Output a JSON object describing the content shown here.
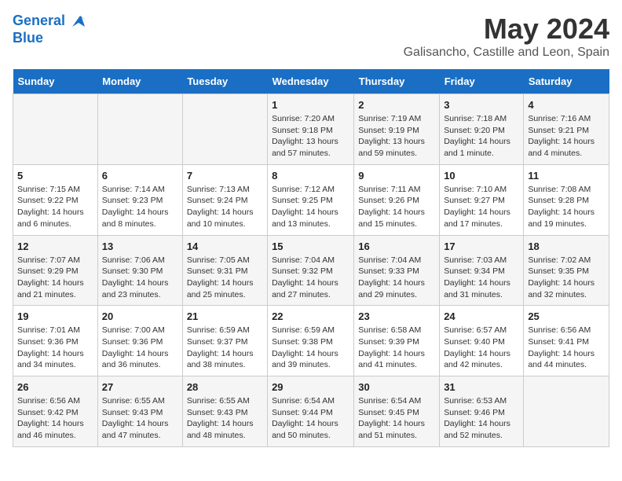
{
  "header": {
    "logo_line1": "General",
    "logo_line2": "Blue",
    "title": "May 2024",
    "subtitle": "Galisancho, Castille and Leon, Spain"
  },
  "days_of_week": [
    "Sunday",
    "Monday",
    "Tuesday",
    "Wednesday",
    "Thursday",
    "Friday",
    "Saturday"
  ],
  "weeks": [
    [
      {
        "num": "",
        "sunrise": "",
        "sunset": "",
        "daylight": ""
      },
      {
        "num": "",
        "sunrise": "",
        "sunset": "",
        "daylight": ""
      },
      {
        "num": "",
        "sunrise": "",
        "sunset": "",
        "daylight": ""
      },
      {
        "num": "1",
        "sunrise": "Sunrise: 7:20 AM",
        "sunset": "Sunset: 9:18 PM",
        "daylight": "Daylight: 13 hours and 57 minutes."
      },
      {
        "num": "2",
        "sunrise": "Sunrise: 7:19 AM",
        "sunset": "Sunset: 9:19 PM",
        "daylight": "Daylight: 13 hours and 59 minutes."
      },
      {
        "num": "3",
        "sunrise": "Sunrise: 7:18 AM",
        "sunset": "Sunset: 9:20 PM",
        "daylight": "Daylight: 14 hours and 1 minute."
      },
      {
        "num": "4",
        "sunrise": "Sunrise: 7:16 AM",
        "sunset": "Sunset: 9:21 PM",
        "daylight": "Daylight: 14 hours and 4 minutes."
      }
    ],
    [
      {
        "num": "5",
        "sunrise": "Sunrise: 7:15 AM",
        "sunset": "Sunset: 9:22 PM",
        "daylight": "Daylight: 14 hours and 6 minutes."
      },
      {
        "num": "6",
        "sunrise": "Sunrise: 7:14 AM",
        "sunset": "Sunset: 9:23 PM",
        "daylight": "Daylight: 14 hours and 8 minutes."
      },
      {
        "num": "7",
        "sunrise": "Sunrise: 7:13 AM",
        "sunset": "Sunset: 9:24 PM",
        "daylight": "Daylight: 14 hours and 10 minutes."
      },
      {
        "num": "8",
        "sunrise": "Sunrise: 7:12 AM",
        "sunset": "Sunset: 9:25 PM",
        "daylight": "Daylight: 14 hours and 13 minutes."
      },
      {
        "num": "9",
        "sunrise": "Sunrise: 7:11 AM",
        "sunset": "Sunset: 9:26 PM",
        "daylight": "Daylight: 14 hours and 15 minutes."
      },
      {
        "num": "10",
        "sunrise": "Sunrise: 7:10 AM",
        "sunset": "Sunset: 9:27 PM",
        "daylight": "Daylight: 14 hours and 17 minutes."
      },
      {
        "num": "11",
        "sunrise": "Sunrise: 7:08 AM",
        "sunset": "Sunset: 9:28 PM",
        "daylight": "Daylight: 14 hours and 19 minutes."
      }
    ],
    [
      {
        "num": "12",
        "sunrise": "Sunrise: 7:07 AM",
        "sunset": "Sunset: 9:29 PM",
        "daylight": "Daylight: 14 hours and 21 minutes."
      },
      {
        "num": "13",
        "sunrise": "Sunrise: 7:06 AM",
        "sunset": "Sunset: 9:30 PM",
        "daylight": "Daylight: 14 hours and 23 minutes."
      },
      {
        "num": "14",
        "sunrise": "Sunrise: 7:05 AM",
        "sunset": "Sunset: 9:31 PM",
        "daylight": "Daylight: 14 hours and 25 minutes."
      },
      {
        "num": "15",
        "sunrise": "Sunrise: 7:04 AM",
        "sunset": "Sunset: 9:32 PM",
        "daylight": "Daylight: 14 hours and 27 minutes."
      },
      {
        "num": "16",
        "sunrise": "Sunrise: 7:04 AM",
        "sunset": "Sunset: 9:33 PM",
        "daylight": "Daylight: 14 hours and 29 minutes."
      },
      {
        "num": "17",
        "sunrise": "Sunrise: 7:03 AM",
        "sunset": "Sunset: 9:34 PM",
        "daylight": "Daylight: 14 hours and 31 minutes."
      },
      {
        "num": "18",
        "sunrise": "Sunrise: 7:02 AM",
        "sunset": "Sunset: 9:35 PM",
        "daylight": "Daylight: 14 hours and 32 minutes."
      }
    ],
    [
      {
        "num": "19",
        "sunrise": "Sunrise: 7:01 AM",
        "sunset": "Sunset: 9:36 PM",
        "daylight": "Daylight: 14 hours and 34 minutes."
      },
      {
        "num": "20",
        "sunrise": "Sunrise: 7:00 AM",
        "sunset": "Sunset: 9:36 PM",
        "daylight": "Daylight: 14 hours and 36 minutes."
      },
      {
        "num": "21",
        "sunrise": "Sunrise: 6:59 AM",
        "sunset": "Sunset: 9:37 PM",
        "daylight": "Daylight: 14 hours and 38 minutes."
      },
      {
        "num": "22",
        "sunrise": "Sunrise: 6:59 AM",
        "sunset": "Sunset: 9:38 PM",
        "daylight": "Daylight: 14 hours and 39 minutes."
      },
      {
        "num": "23",
        "sunrise": "Sunrise: 6:58 AM",
        "sunset": "Sunset: 9:39 PM",
        "daylight": "Daylight: 14 hours and 41 minutes."
      },
      {
        "num": "24",
        "sunrise": "Sunrise: 6:57 AM",
        "sunset": "Sunset: 9:40 PM",
        "daylight": "Daylight: 14 hours and 42 minutes."
      },
      {
        "num": "25",
        "sunrise": "Sunrise: 6:56 AM",
        "sunset": "Sunset: 9:41 PM",
        "daylight": "Daylight: 14 hours and 44 minutes."
      }
    ],
    [
      {
        "num": "26",
        "sunrise": "Sunrise: 6:56 AM",
        "sunset": "Sunset: 9:42 PM",
        "daylight": "Daylight: 14 hours and 46 minutes."
      },
      {
        "num": "27",
        "sunrise": "Sunrise: 6:55 AM",
        "sunset": "Sunset: 9:43 PM",
        "daylight": "Daylight: 14 hours and 47 minutes."
      },
      {
        "num": "28",
        "sunrise": "Sunrise: 6:55 AM",
        "sunset": "Sunset: 9:43 PM",
        "daylight": "Daylight: 14 hours and 48 minutes."
      },
      {
        "num": "29",
        "sunrise": "Sunrise: 6:54 AM",
        "sunset": "Sunset: 9:44 PM",
        "daylight": "Daylight: 14 hours and 50 minutes."
      },
      {
        "num": "30",
        "sunrise": "Sunrise: 6:54 AM",
        "sunset": "Sunset: 9:45 PM",
        "daylight": "Daylight: 14 hours and 51 minutes."
      },
      {
        "num": "31",
        "sunrise": "Sunrise: 6:53 AM",
        "sunset": "Sunset: 9:46 PM",
        "daylight": "Daylight: 14 hours and 52 minutes."
      },
      {
        "num": "",
        "sunrise": "",
        "sunset": "",
        "daylight": ""
      }
    ]
  ]
}
